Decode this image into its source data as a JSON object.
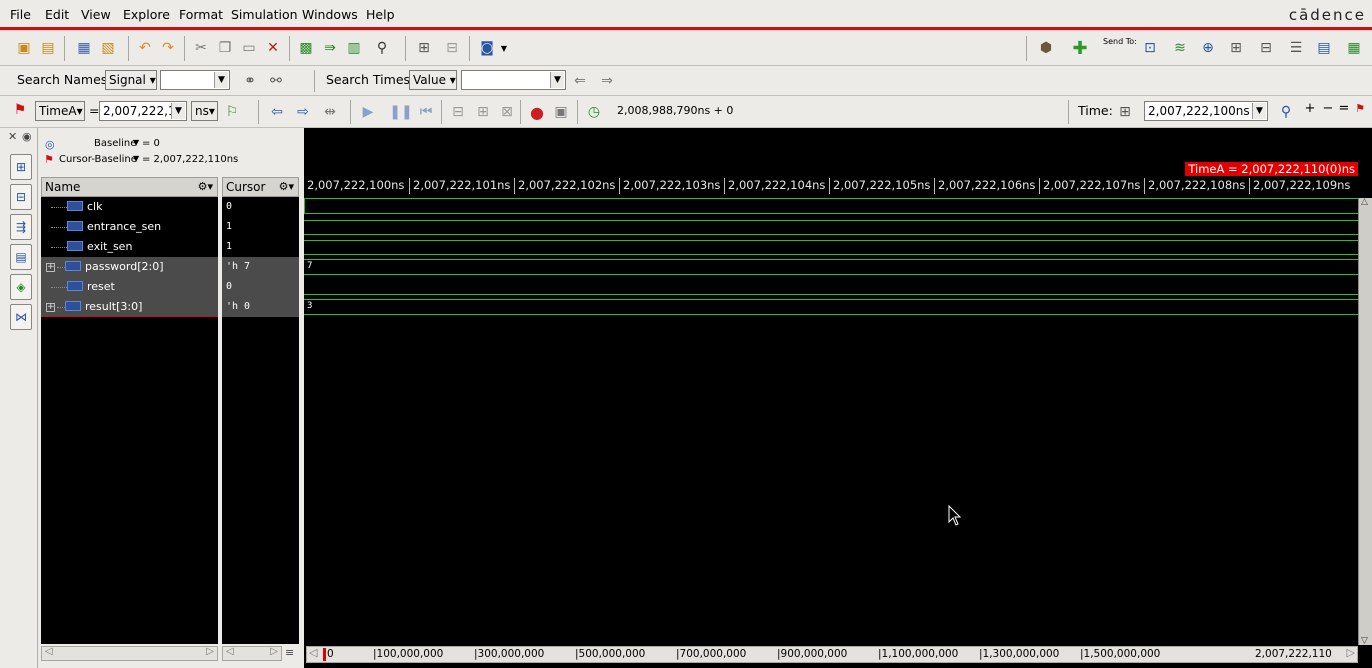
{
  "menu": [
    "File",
    "Edit",
    "View",
    "Explore",
    "Format",
    "Simulation",
    "Windows",
    "Help"
  ],
  "brand": "cādence",
  "search": {
    "names_label": "Search Names:",
    "names_mode": "Signal",
    "names_value": "",
    "times_label": "Search Times:",
    "times_mode": "Value",
    "times_value": ""
  },
  "cursor_bar": {
    "marker": "TimeA",
    "equals": "=",
    "time_value": "2,007,222,1",
    "unit": "ns",
    "sim_time": "2,008,988,790ns + 0",
    "time_label": "Time:",
    "time_field": "2,007,222,100ns :"
  },
  "baseline": {
    "baseline_label": "Baseline",
    "baseline_value": "= 0",
    "cursor_baseline_label": "Cursor-Baseline",
    "cursor_baseline_value": "= 2,007,222,110ns"
  },
  "columns": {
    "name": "Name",
    "cursor": "Cursor"
  },
  "signals": [
    {
      "name": "clk",
      "cursor": "0",
      "wave": "",
      "bus": false,
      "expandable": false
    },
    {
      "name": "entrance_sen",
      "cursor": "1",
      "wave": "",
      "bus": false,
      "expandable": false
    },
    {
      "name": "exit_sen",
      "cursor": "1",
      "wave": "",
      "bus": false,
      "expandable": false
    },
    {
      "name": "password[2:0]",
      "cursor": "'h 7",
      "wave": "7",
      "bus": true,
      "expandable": true
    },
    {
      "name": "reset",
      "cursor": "0",
      "wave": "",
      "bus": false,
      "expandable": false
    },
    {
      "name": "result[3:0]",
      "cursor": "'h 0",
      "wave": "3",
      "bus": true,
      "expandable": true
    }
  ],
  "time_axis": [
    "2,007,222,100ns",
    "2,007,222,101ns",
    "2,007,222,102ns",
    "2,007,222,103ns",
    "2,007,222,104ns",
    "2,007,222,105ns",
    "2,007,222,106ns",
    "2,007,222,107ns",
    "2,007,222,108ns",
    "2,007,222,109ns"
  ],
  "cursor_badge": "TimeA = 2,007,222,110(0)ns",
  "overview_ticks": [
    "0",
    "|100,000,000",
    "|300,000,000",
    "|500,000,000",
    "|700,000,000",
    "|900,000,000",
    "|1,100,000,000",
    "|1,300,000,000",
    "|1,500,000,000",
    "2,007,222,110"
  ],
  "toolbar_send_to": "Send To:",
  "colors": {
    "menu_rule": "#cc1010",
    "wave": "#2dbd2d",
    "cursor": "#e00000",
    "canvas": "#000000"
  }
}
